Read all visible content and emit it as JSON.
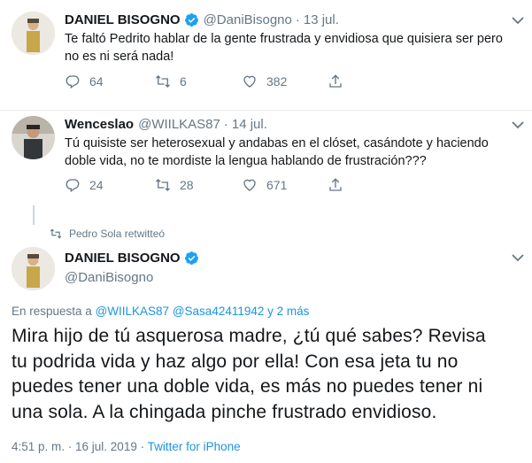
{
  "tweet1": {
    "name": "DANIEL BISOGNO",
    "handle": "@DaniBisogno",
    "separator": "·",
    "time": "13 jul.",
    "text_line1": "Te faltó Pedrito hablar de la gente frustrada y envidiosa que quisiera ser pero",
    "text_line2": "no es ni será nada!",
    "replies": "64",
    "retweets": "6",
    "likes": "382"
  },
  "tweet2": {
    "name": "Wenceslao",
    "handle": "@WIILKAS87",
    "separator": "·",
    "time": "14 jul.",
    "text_line1": "Tú quisiste ser heterosexual y andabas en el clóset, casándote y haciendo",
    "text_line2": "doble vida, no te mordiste la lengua hablando de frustración???",
    "replies": "24",
    "retweets": "28",
    "likes": "671"
  },
  "retweeted_by": "Pedro Sola retwitteó",
  "main_tweet": {
    "name": "DANIEL BISOGNO",
    "handle": "@DaniBisogno",
    "reply_prefix": "En respuesta a",
    "reply_user1": "@WIILKAS87",
    "reply_user2": "@Sasa42411942",
    "reply_more": "y 2 más",
    "text_line1": "Mira hijo de tú asquerosa madre, ¿tú qué sabes? Revisa",
    "text_line2": "tu podrida vida y haz algo por ella! Con esa jeta tu no",
    "text_line3": "puedes tener una doble vida, es más no puedes tener ni",
    "text_line4": "una sola. A la chingada pinche frustrado envidioso.",
    "timestamp": "4:51 p. m. · 16 jul. 2019 ·",
    "source": "Twitter for iPhone"
  },
  "colors": {
    "verified": "#1da1f2",
    "link": "#1b95e0",
    "secondary_text": "#657786",
    "primary_text": "#14171a"
  },
  "icons": [
    "reply-icon",
    "retweet-icon",
    "like-icon",
    "share-icon",
    "verified-badge-icon",
    "chevron-down-icon"
  ]
}
